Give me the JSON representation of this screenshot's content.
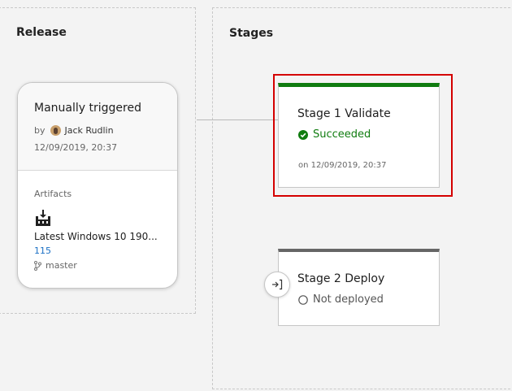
{
  "release": {
    "heading": "Release",
    "trigger_title": "Manually triggered",
    "by_label": "by",
    "author": "Jack Rudlin",
    "date": "12/09/2019, 20:37",
    "artifacts_label": "Artifacts",
    "artifact_icon": "artifact-build-icon",
    "artifact_name": "Latest Windows 10 190...",
    "artifact_version": "115",
    "branch_icon": "branch-icon",
    "branch": "master"
  },
  "stages": {
    "heading": "Stages",
    "items": [
      {
        "name": "Stage 1 Validate",
        "status": "Succeeded",
        "status_icon": "check-circle-icon",
        "status_color": "#107c10",
        "date": "on 12/09/2019, 20:37",
        "bar_color": "#107c10"
      },
      {
        "name": "Stage 2 Deploy",
        "status": "Not deployed",
        "status_icon": "empty-circle-icon",
        "status_color": "#555555",
        "bar_color": "#666666"
      }
    ]
  },
  "colors": {
    "highlight": "#d40000",
    "link": "#1a6fc4"
  }
}
